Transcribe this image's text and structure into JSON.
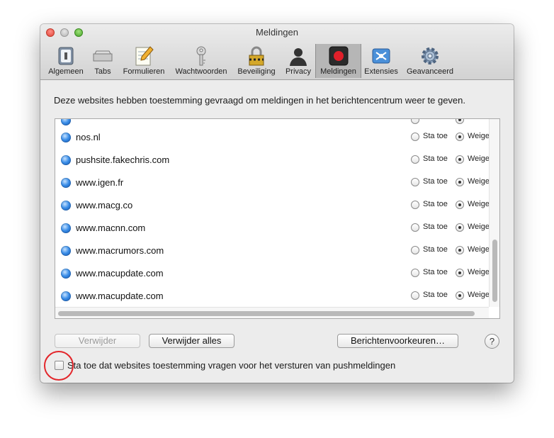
{
  "window": {
    "title": "Meldingen"
  },
  "toolbar": {
    "items": [
      {
        "label": "Algemeen",
        "icon": "general-switch-icon"
      },
      {
        "label": "Tabs",
        "icon": "tabs-icon"
      },
      {
        "label": "Formulieren",
        "icon": "forms-pencil-icon"
      },
      {
        "label": "Wachtwoorden",
        "icon": "key-icon"
      },
      {
        "label": "Beveiliging",
        "icon": "padlock-icon"
      },
      {
        "label": "Privacy",
        "icon": "person-silhouette-icon"
      },
      {
        "label": "Meldingen",
        "icon": "notifications-record-icon",
        "selected": true
      },
      {
        "label": "Extensies",
        "icon": "extensions-puzzle-icon"
      },
      {
        "label": "Geavanceerd",
        "icon": "gear-icon"
      }
    ]
  },
  "intro_text": "Deze websites hebben toestemming gevraagd om meldingen in het berichtencentrum weer te geven.",
  "list": {
    "option_allow": "Sta toe",
    "option_deny": "Weige",
    "sites": [
      {
        "name": "nos.nl",
        "selected": "deny"
      },
      {
        "name": "pushsite.fakechris.com",
        "selected": "deny"
      },
      {
        "name": "www.igen.fr",
        "selected": "deny"
      },
      {
        "name": "www.macg.co",
        "selected": "deny"
      },
      {
        "name": "www.macnn.com",
        "selected": "deny"
      },
      {
        "name": "www.macrumors.com",
        "selected": "deny"
      },
      {
        "name": "www.macupdate.com",
        "selected": "deny"
      },
      {
        "name": "www.macupdate.com",
        "selected": "deny"
      }
    ]
  },
  "buttons": {
    "remove": "Verwijder",
    "remove_all": "Verwijder alles",
    "notification_prefs": "Berichtenvoorkeuren…",
    "help": "?"
  },
  "checkbox": {
    "label": "Sta toe dat websites toestemming vragen voor het versturen van pushmeldingen",
    "checked": false
  },
  "colors": {
    "selected_tab_bg": "#b6b6b6",
    "annotation_circle": "#e3262b",
    "globe_blue": "#3b8ee8"
  }
}
